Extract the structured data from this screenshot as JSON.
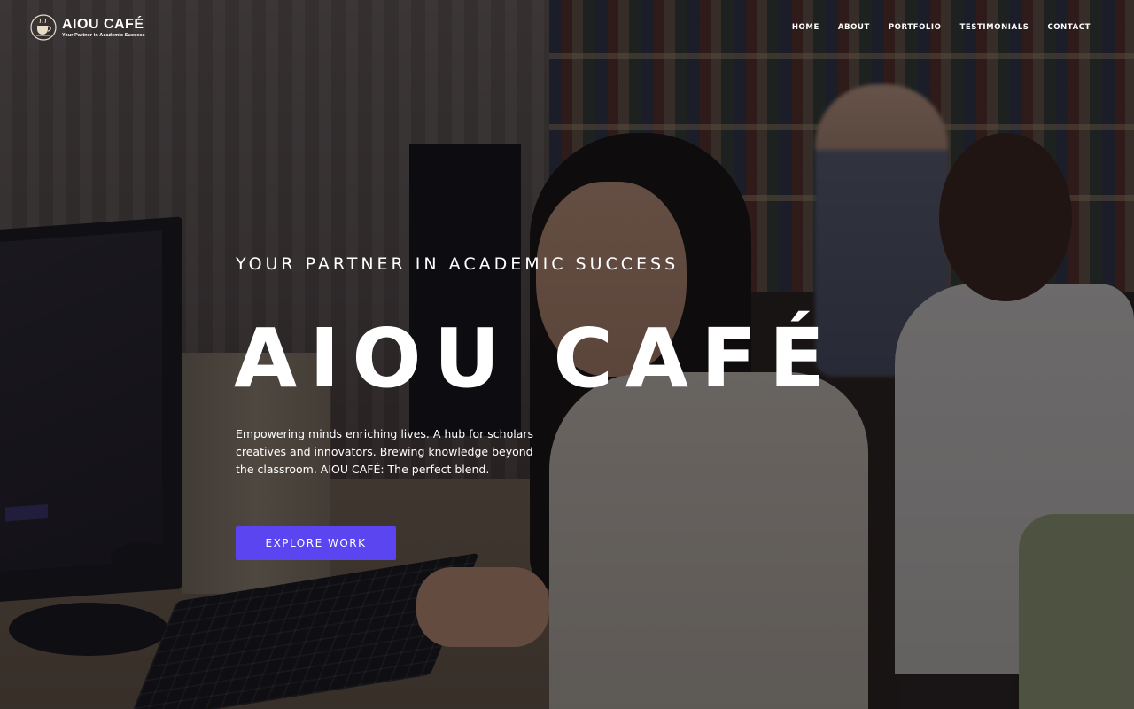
{
  "brand": {
    "name": "AIOU CAFÉ",
    "tagline": "Your Partner in Academic Success",
    "emblem_icon": "cup-emblem-icon"
  },
  "nav": {
    "items": [
      {
        "label": "HOME"
      },
      {
        "label": "ABOUT"
      },
      {
        "label": "PORTFOLIO"
      },
      {
        "label": "TESTIMONIALS"
      },
      {
        "label": "CONTACT"
      }
    ]
  },
  "hero": {
    "kicker": "YOUR PARTNER IN ACADEMIC SUCCESS",
    "title": "AIOU CAFÉ",
    "description": "Empowering minds enriching lives. A hub for scholars creatives and innovators. Brewing knowledge beyond the classroom. AIOU CAFÉ: The perfect blend.",
    "cta_label": "EXPLORE WORK"
  },
  "colors": {
    "accent": "#5a45f0",
    "text": "#ffffff"
  }
}
